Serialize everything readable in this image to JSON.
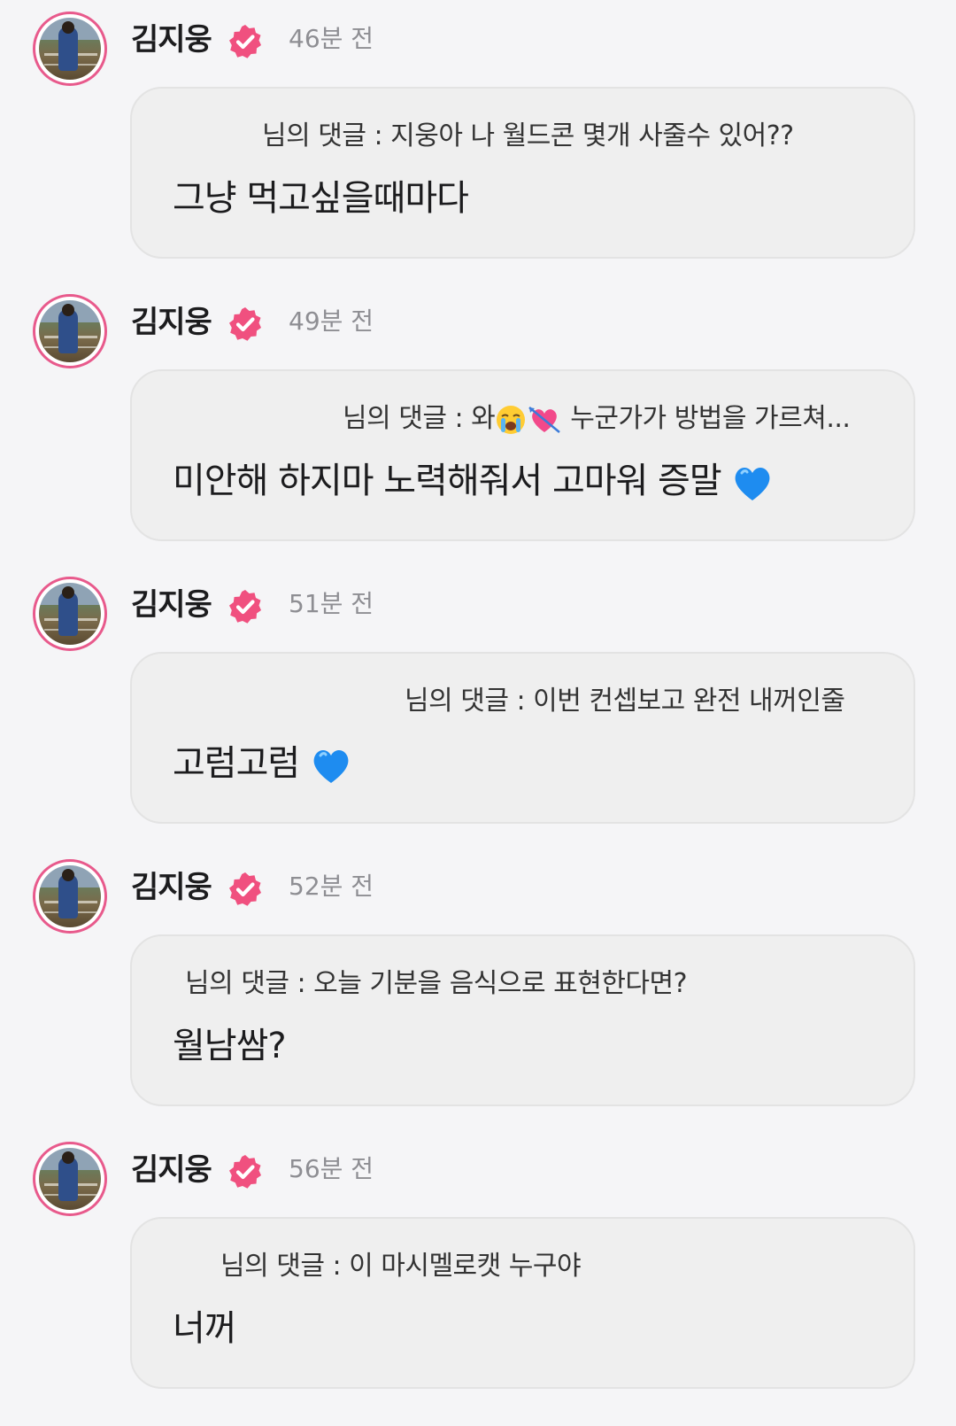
{
  "posts": [
    {
      "author": "김지웅",
      "time": "46분 전",
      "quoted": "님의 댓글 : 지웅아 나 월드콘 몇개 사줄수 있어??",
      "reply": "그냥 먹고싶을때마다",
      "reply_emoji": ""
    },
    {
      "author": "김지웅",
      "time": "49분 전",
      "quoted_prefix": "님의 댓글 : 와",
      "quoted_suffix": " 누군가가 방법을 가르쳐...",
      "quoted_emojis": [
        "loudly-crying-face",
        "heart-with-arrow"
      ],
      "reply": "미안해 하지마 노력해줘서 고마워 증말 ",
      "reply_emoji": "blue-heart"
    },
    {
      "author": "김지웅",
      "time": "51분 전",
      "quoted": "님의 댓글 : 이번 컨셉보고 완전 내꺼인줄",
      "reply": "고럼고럼 ",
      "reply_emoji": "blue-heart"
    },
    {
      "author": "김지웅",
      "time": "52분 전",
      "quoted": "님의 댓글 : 오늘 기분을 음식으로 표현한다면?",
      "reply": "월남쌈?",
      "reply_emoji": ""
    },
    {
      "author": "김지웅",
      "time": "56분 전",
      "quoted": "님의 댓글 : 이 마시멜로캣 누구야",
      "reply": "너꺼",
      "reply_emoji": ""
    }
  ],
  "colors": {
    "accent": "#e85a8c",
    "badge": "#f0507f",
    "background": "#f5f5f7",
    "bubble": "#efefef",
    "time": "#8e8e93"
  },
  "icons": {
    "verified": "verified-badge-icon",
    "avatar": "profile-photo"
  }
}
